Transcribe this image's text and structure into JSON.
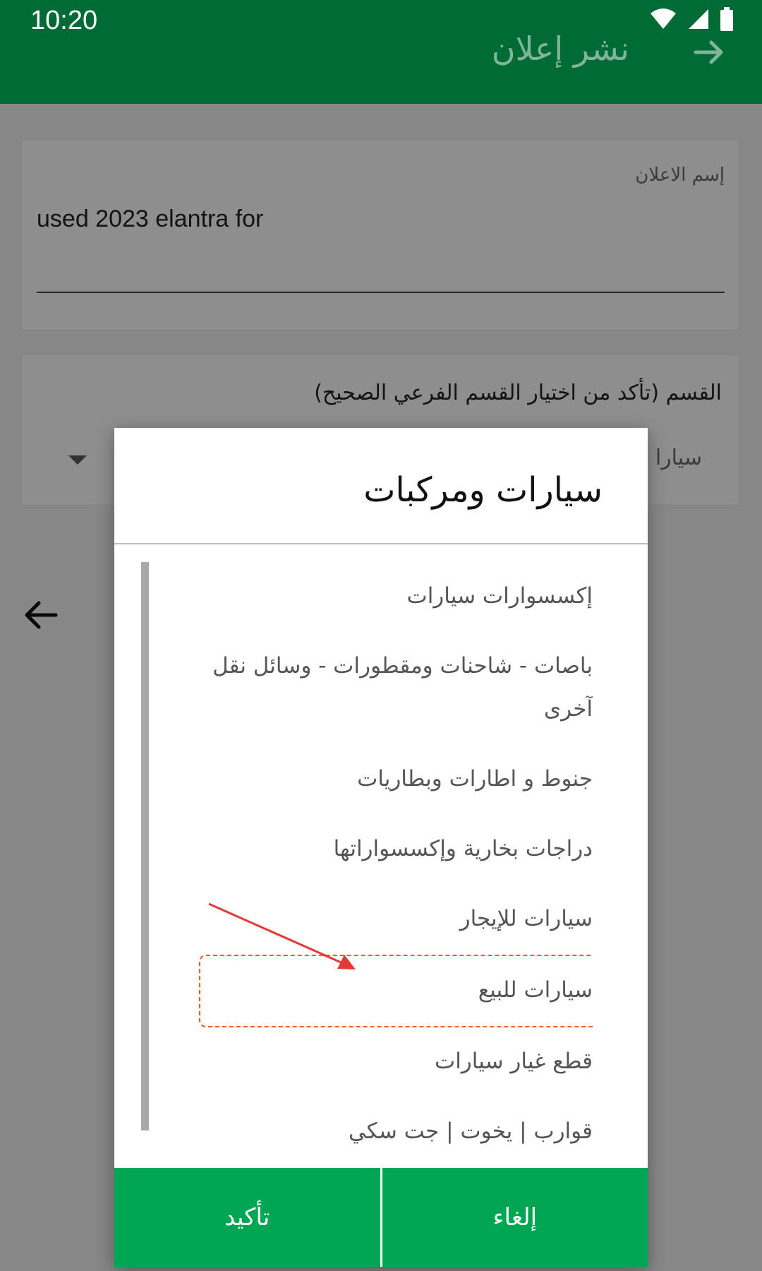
{
  "status_bar": {
    "time": "10:20"
  },
  "app_bar": {
    "title": "نشر إعلان"
  },
  "ad_name_field": {
    "label": "إسم الاعلان",
    "value": "used 2023 elantra for"
  },
  "category_field": {
    "label": "القسم (تأكد من اختيار القسم الفرعي الصحيح)",
    "value": "سيارا"
  },
  "dialog": {
    "title": "سيارات ومركبات",
    "options": [
      "إكسسوارات سيارات",
      "باصات - شاحنات ومقطورات - وسائل نقل آخرى",
      "جنوط و اطارات وبطاريات",
      "دراجات بخارية وإكسسواراتها",
      "سيارات للإيجار",
      "سيارات للبيع",
      "قطع غيار سيارات",
      "قوارب | يخوت | جت سكي"
    ],
    "confirm_label": "تأكيد",
    "cancel_label": "إلغاء"
  },
  "colors": {
    "app_bar": "#006b35",
    "dialog_buttons": "#00a651",
    "highlight": "#ff5722",
    "annotation_arrow": "#e53935"
  },
  "icons": [
    "wifi-icon",
    "signal-icon",
    "battery-icon",
    "arrow-forward-icon",
    "arrow-back-icon"
  ]
}
